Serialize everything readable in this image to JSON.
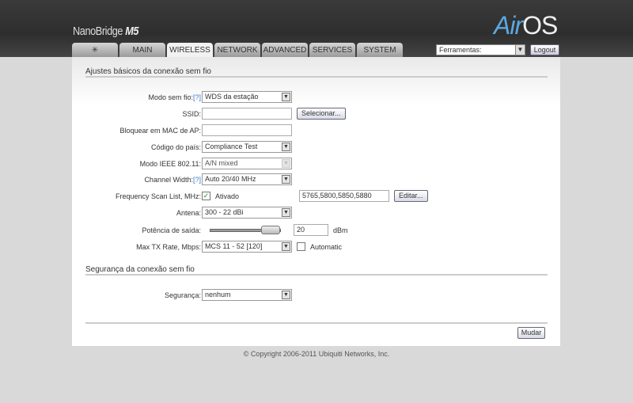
{
  "header": {
    "brand": "NanoBridge",
    "model": "M5",
    "logo_air": "Air",
    "logo_os": "OS",
    "tools_select": "Ferramentas:",
    "logout": "Logout"
  },
  "tabs": [
    {
      "label": "",
      "icon": "ubiquiti-logo-icon"
    },
    {
      "label": "MAIN"
    },
    {
      "label": "WIRELESS",
      "active": true
    },
    {
      "label": "NETWORK"
    },
    {
      "label": "ADVANCED"
    },
    {
      "label": "SERVICES"
    },
    {
      "label": "SYSTEM"
    }
  ],
  "basic": {
    "title": "Ajustes básicos da conexão sem fio",
    "mode_label": "Modo sem fio:",
    "help": "[?]",
    "mode_value": "WDS da estação",
    "ssid_label": "SSID:",
    "ssid_value": "",
    "select_btn": "Selecionar...",
    "lock_label": "Bloquear em MAC de AP:",
    "lock_value": "",
    "country_label": "Código do país:",
    "country_value": "Compliance Test",
    "ieee_label": "Modo IEEE 802.11:",
    "ieee_value": "A/N mixed",
    "cw_label": "Channel Width:",
    "cw_value": "Auto 20/40 MHz",
    "fsl_label": "Frequency Scan List, MHz:",
    "fsl_enabled": "Ativado",
    "fsl_value": "5765,5800,5850,5880",
    "edit_btn": "Editar...",
    "antenna_label": "Antena:",
    "antenna_value": "300 - 22 dBi",
    "power_label": "Potência de saída:",
    "power_value": "20",
    "power_unit": "dBm",
    "power_slider_fraction": 0.85,
    "rate_label": "Max TX Rate, Mbps:",
    "rate_value": "MCS 11 - 52 [120]",
    "auto_label": "Automatic"
  },
  "security": {
    "title": "Segurança da conexão sem fio",
    "label": "Segurança:",
    "value": "nenhum"
  },
  "apply_btn": "Mudar",
  "copyright": "© Copyright 2006-2011 Ubiquiti Networks, Inc."
}
